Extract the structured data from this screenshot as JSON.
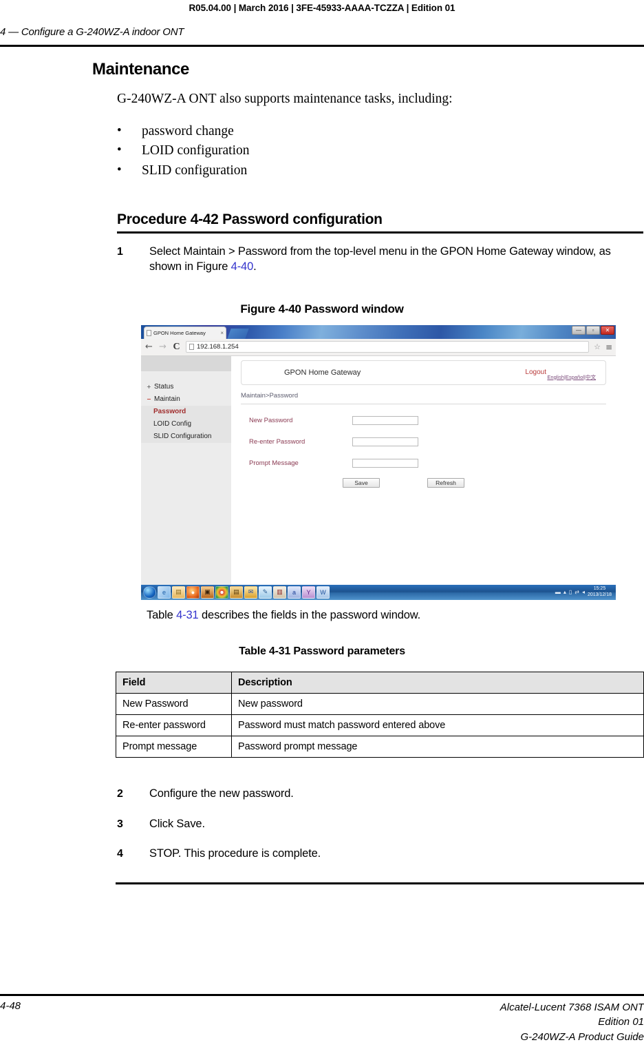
{
  "header": {
    "meta": "R05.04.00 | March 2016 | 3FE-45933-AAAA-TCZZA | Edition 01",
    "running_head": "4 —  Configure a G-240WZ-A indoor ONT"
  },
  "section": {
    "title": "Maintenance",
    "intro": "G-240WZ-A ONT also supports maintenance tasks, including:",
    "bullets": [
      "password change",
      "LOID configuration",
      "SLID configuration"
    ]
  },
  "procedure": {
    "heading": "Procedure 4-42  Password configuration",
    "steps": [
      {
        "num": "1",
        "text_before": "Select Maintain > Password from the top-level menu in the GPON Home Gateway window, as shown in Figure ",
        "xref": "4-40",
        "text_after": "."
      },
      {
        "num": "2",
        "text_before": "Configure the new password.",
        "xref": "",
        "text_after": ""
      },
      {
        "num": "3",
        "text_before": "Click Save.",
        "xref": "",
        "text_after": ""
      },
      {
        "num": "4",
        "text_before": "STOP. This procedure is complete.",
        "xref": "",
        "text_after": ""
      }
    ]
  },
  "figure": {
    "caption": "Figure 4-40  Password window",
    "browser": {
      "tab_title": "GPON Home Gateway",
      "tab_close": "×",
      "back_icon": "←",
      "forward_icon": "→",
      "reload_icon": "C",
      "url": "192.168.1.254",
      "star_icon": "☆",
      "menu_icon": "≡",
      "minimize_label": "—",
      "maximize_label": "▫",
      "close_label": "✕"
    },
    "gateway": {
      "title": "GPON Home Gateway",
      "logout": "Logout",
      "languages": "English|Español|中文",
      "breadcrumb": "Maintain>Password",
      "sidebar": [
        {
          "label": "Status",
          "expander": "+",
          "level": "top",
          "active": false
        },
        {
          "label": "Maintain",
          "expander": "−",
          "level": "top",
          "active": false
        },
        {
          "label": "Password",
          "expander": "",
          "level": "sub",
          "active": true
        },
        {
          "label": "LOID Config",
          "expander": "",
          "level": "sub",
          "active": false
        },
        {
          "label": "SLID Configuration",
          "expander": "",
          "level": "sub",
          "active": false
        }
      ],
      "fields": [
        {
          "label": "New Password",
          "value": ""
        },
        {
          "label": "Re-enter Password",
          "value": ""
        },
        {
          "label": "Prompt Message",
          "value": ""
        }
      ],
      "save_label": "Save",
      "refresh_label": "Refresh"
    },
    "taskbar": {
      "icons": [
        "start-orb",
        "internet-explorer",
        "folder",
        "firefox",
        "media-player",
        "chrome",
        "notebook",
        "outlook",
        "paint",
        "printer",
        "messenger",
        "yahoo",
        "word"
      ],
      "tray": [
        "show-desktop",
        "arrow-up",
        "battery",
        "network",
        "volume"
      ],
      "time": "15:25",
      "date": "2013/12/18"
    }
  },
  "table_intro": {
    "text_before": "Table ",
    "xref": "4-31",
    "text_after": " describes the fields in the password window."
  },
  "table": {
    "caption": "Table 4-31 Password parameters",
    "columns": [
      "Field",
      "Description"
    ],
    "rows": [
      [
        "New Password",
        "New password"
      ],
      [
        "Re-enter password",
        "Password must match password entered above"
      ],
      [
        "Prompt message",
        "Password prompt message"
      ]
    ]
  },
  "footer": {
    "page": "4-48",
    "line1": "Alcatel-Lucent 7368 ISAM ONT",
    "line2": "Edition 01",
    "line3": "G-240WZ-A Product Guide"
  }
}
